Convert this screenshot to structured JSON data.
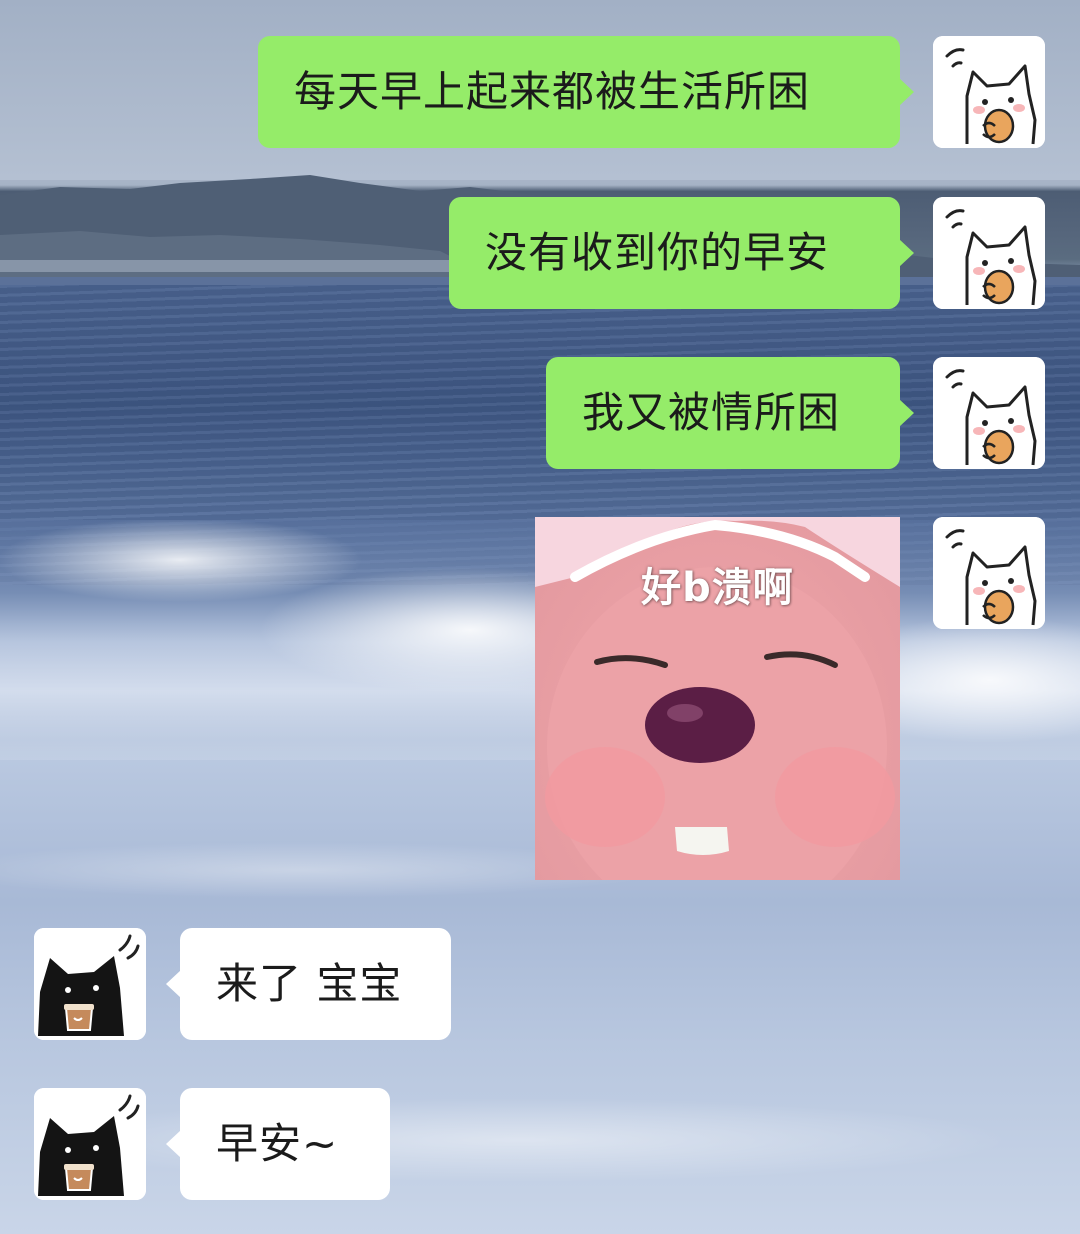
{
  "messages_out": [
    {
      "text": "每天早上起来都被生活所困"
    },
    {
      "text": "没有收到你的早安"
    },
    {
      "text": "我又被情所困"
    }
  ],
  "sticker": {
    "caption": "好b溃啊"
  },
  "messages_in": [
    {
      "text": "来了 宝宝"
    },
    {
      "text": "早安~"
    }
  ],
  "colors": {
    "outgoing_bubble": "#95ec69",
    "incoming_bubble": "#ffffff",
    "sticker_bg": "#eaa0a5"
  },
  "icons": {
    "self_avatar": "white-cat-eating-cookie-avatar",
    "contact_avatar": "black-cat-drinking-coffee-avatar"
  }
}
